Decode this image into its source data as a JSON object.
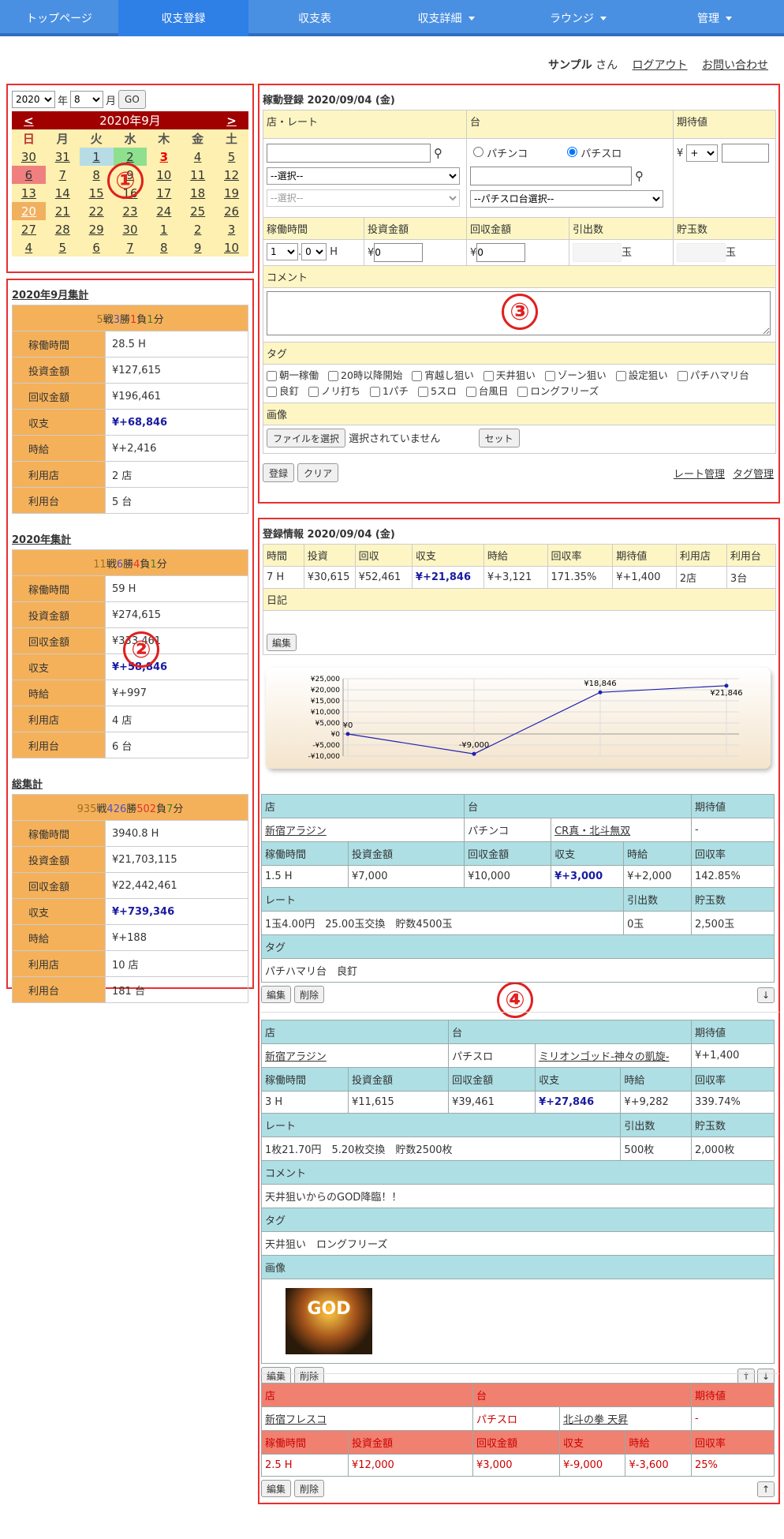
{
  "nav": {
    "items": [
      "トップページ",
      "収支登録",
      "収支表",
      "収支詳細",
      "ラウンジ",
      "管理"
    ]
  },
  "userbar": {
    "user": "サンプル",
    "san": "さん",
    "logout": "ログアウト",
    "contact": "お問い合わせ"
  },
  "markers": [
    "①",
    "②",
    "③",
    "④"
  ],
  "calendar": {
    "year": "2020",
    "year_unit": "年",
    "month": "8",
    "month_unit": "月",
    "go": "GO",
    "prev": "<",
    "next": ">",
    "title": "2020年9月",
    "weekdays": [
      "日",
      "月",
      "火",
      "水",
      "木",
      "金",
      "土"
    ],
    "rows": [
      [
        "30",
        "31",
        "1",
        "2",
        "3",
        "4",
        "5"
      ],
      [
        "6",
        "7",
        "8",
        "9",
        "10",
        "11",
        "12"
      ],
      [
        "13",
        "14",
        "15",
        "16",
        "17",
        "18",
        "19"
      ],
      [
        "20",
        "21",
        "22",
        "23",
        "24",
        "25",
        "26"
      ],
      [
        "27",
        "28",
        "29",
        "30",
        "1",
        "2",
        "3"
      ],
      [
        "4",
        "5",
        "6",
        "7",
        "8",
        "9",
        "10"
      ]
    ]
  },
  "month_summary": {
    "title": "2020年9月集計",
    "win": "5",
    "win_l": "戦",
    "w2": "3",
    "w2_l": "勝",
    "lose": "1",
    "lose_l": "負",
    "draw": "1",
    "draw_l": "分",
    "rows": [
      [
        "稼働時間",
        "28.5 H"
      ],
      [
        "投資金額",
        "¥127,615"
      ],
      [
        "回収金額",
        "¥196,461"
      ],
      [
        "収支",
        "¥+68,846"
      ],
      [
        "時給",
        "¥+2,416"
      ],
      [
        "利用店",
        "2 店"
      ],
      [
        "利用台",
        "5 台"
      ]
    ]
  },
  "year_summary": {
    "title": "2020年集計",
    "win": "11",
    "w2": "6",
    "lose": "4",
    "draw": "1",
    "rows": [
      [
        "稼働時間",
        "59 H"
      ],
      [
        "投資金額",
        "¥274,615"
      ],
      [
        "回収金額",
        "¥333,461"
      ],
      [
        "収支",
        "¥+58,846"
      ],
      [
        "時給",
        "¥+997"
      ],
      [
        "利用店",
        "4 店"
      ],
      [
        "利用台",
        "6 台"
      ]
    ]
  },
  "total_summary": {
    "title": "総集計",
    "win": "935",
    "w2": "426",
    "lose": "502",
    "draw": "7",
    "rows": [
      [
        "稼働時間",
        "3940.8 H"
      ],
      [
        "投資金額",
        "¥21,703,115"
      ],
      [
        "回収金額",
        "¥22,442,461"
      ],
      [
        "収支",
        "¥+739,346"
      ],
      [
        "時給",
        "¥+188"
      ],
      [
        "利用店",
        "10 店"
      ],
      [
        "利用台",
        "181 台"
      ]
    ]
  },
  "form": {
    "title": "稼動登録 2020/09/04 (金)",
    "store_rate": "店・レート",
    "machine": "台",
    "expect": "期待値",
    "select": "--選択--",
    "pachinko": "パチンコ",
    "pachislot": "パチスロ",
    "slot_select": "--パチスロ台選択--",
    "yen": "¥",
    "plus": "+",
    "time": "稼働時間",
    "invest": "投資金額",
    "recover": "回収金額",
    "draw_count": "引出数",
    "save_count": "貯玉数",
    "hour": "1",
    "minute": "0",
    "h": "H",
    "zero": "0",
    "ball": "玉",
    "comment": "コメント",
    "tag": "タグ",
    "tags": [
      "朝一稼働",
      "20時以降開始",
      "宵越し狙い",
      "天井狙い",
      "ゾーン狙い",
      "設定狙い",
      "パチハマリ台",
      "良釘",
      "ノリ打ち",
      "1パチ",
      "5スロ",
      "台風日",
      "ロングフリーズ"
    ],
    "image": "画像",
    "file_btn": "ファイルを選択",
    "no_file": "選択されていません",
    "set": "セット",
    "register": "登録",
    "clear": "クリア",
    "rate_mgmt": "レート管理",
    "tag_mgmt": "タグ管理"
  },
  "info": {
    "title": "登録情報 2020/09/04 (金)",
    "headers": [
      "時間",
      "投資",
      "回収",
      "収支",
      "時給",
      "回収率",
      "期待値",
      "利用店",
      "利用台"
    ],
    "values": [
      "7 H",
      "¥30,615",
      "¥52,461",
      "¥+21,846",
      "¥+3,121",
      "171.35%",
      "¥+1,400",
      "2店",
      "3台"
    ],
    "diary": "日記",
    "edit": "編集"
  },
  "chart_data": {
    "type": "line",
    "y_ticks": [
      "¥25,000",
      "¥20,000",
      "¥15,000",
      "¥10,000",
      "¥5,000",
      "¥0",
      "-¥5,000",
      "-¥10,000"
    ],
    "ylim": [
      -10000,
      25000
    ],
    "values": [
      0,
      -9000,
      18846,
      21846
    ],
    "labels": [
      "¥0",
      "-¥9,000",
      "¥18,846",
      "¥21,846"
    ]
  },
  "records": [
    {
      "store": "新宿アラジン",
      "type": "パチンコ",
      "machine": "CR真・北斗無双",
      "expect": "-",
      "time": "1.5 H",
      "invest": "¥7,000",
      "recover": "¥10,000",
      "balance": "¥+3,000",
      "hourly": "¥+2,000",
      "rate_pct": "142.85%",
      "rate": "1玉4.00円　25.00玉交換　貯数4500玉",
      "draw": "0玉",
      "save": "2,500玉",
      "tags": "パチハマリ台　良釘"
    },
    {
      "store": "新宿アラジン",
      "type": "パチスロ",
      "machine": "ミリオンゴッド-神々の凱旋-",
      "expect": "¥+1,400",
      "time": "3 H",
      "invest": "¥11,615",
      "recover": "¥39,461",
      "balance": "¥+27,846",
      "hourly": "¥+9,282",
      "rate_pct": "339.74%",
      "rate": "1枚21.70円　5.20枚交換　貯数2500枚",
      "draw": "500枚",
      "save": "2,000枚",
      "comment": "天井狙いからのGOD降臨！！",
      "tags": "天井狙い　ロングフリーズ"
    },
    {
      "store": "新宿フレスコ",
      "type": "パチスロ",
      "machine": "北斗の拳 天昇",
      "expect": "-",
      "time": "2.5 H",
      "invest": "¥12,000",
      "recover": "¥3,000",
      "balance": "¥-9,000",
      "hourly": "¥-3,600",
      "rate_pct": "25%"
    }
  ],
  "labels": {
    "store": "店",
    "machine": "台",
    "expect": "期待値",
    "time": "稼働時間",
    "invest": "投資金額",
    "recover": "回収金額",
    "balance": "収支",
    "hourly": "時給",
    "rate_pct": "回収率",
    "rate": "レート",
    "draw": "引出数",
    "save": "貯玉数",
    "tag": "タグ",
    "comment": "コメント",
    "image": "画像",
    "edit": "編集",
    "delete": "削除",
    "up": "↑",
    "down": "↓",
    "god": "GOD"
  }
}
